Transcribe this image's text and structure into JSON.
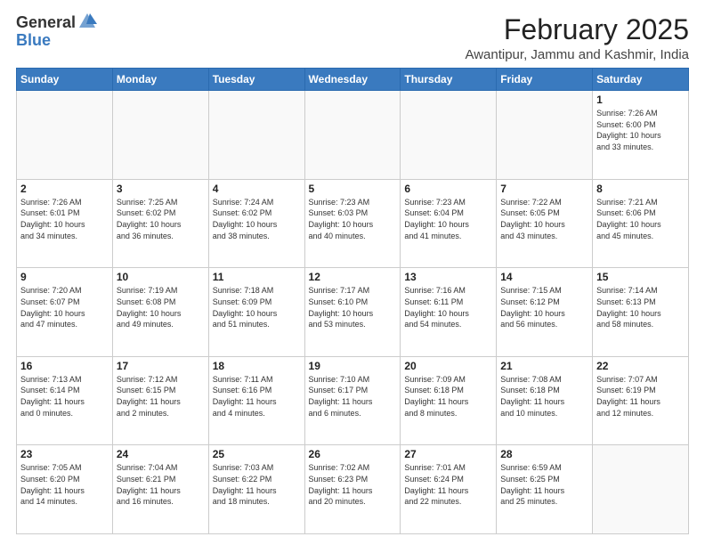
{
  "logo": {
    "general": "General",
    "blue": "Blue"
  },
  "header": {
    "month": "February 2025",
    "location": "Awantipur, Jammu and Kashmir, India"
  },
  "weekdays": [
    "Sunday",
    "Monday",
    "Tuesday",
    "Wednesday",
    "Thursday",
    "Friday",
    "Saturday"
  ],
  "weeks": [
    [
      {
        "day": "",
        "info": ""
      },
      {
        "day": "",
        "info": ""
      },
      {
        "day": "",
        "info": ""
      },
      {
        "day": "",
        "info": ""
      },
      {
        "day": "",
        "info": ""
      },
      {
        "day": "",
        "info": ""
      },
      {
        "day": "1",
        "info": "Sunrise: 7:26 AM\nSunset: 6:00 PM\nDaylight: 10 hours\nand 33 minutes."
      }
    ],
    [
      {
        "day": "2",
        "info": "Sunrise: 7:26 AM\nSunset: 6:01 PM\nDaylight: 10 hours\nand 34 minutes."
      },
      {
        "day": "3",
        "info": "Sunrise: 7:25 AM\nSunset: 6:02 PM\nDaylight: 10 hours\nand 36 minutes."
      },
      {
        "day": "4",
        "info": "Sunrise: 7:24 AM\nSunset: 6:02 PM\nDaylight: 10 hours\nand 38 minutes."
      },
      {
        "day": "5",
        "info": "Sunrise: 7:23 AM\nSunset: 6:03 PM\nDaylight: 10 hours\nand 40 minutes."
      },
      {
        "day": "6",
        "info": "Sunrise: 7:23 AM\nSunset: 6:04 PM\nDaylight: 10 hours\nand 41 minutes."
      },
      {
        "day": "7",
        "info": "Sunrise: 7:22 AM\nSunset: 6:05 PM\nDaylight: 10 hours\nand 43 minutes."
      },
      {
        "day": "8",
        "info": "Sunrise: 7:21 AM\nSunset: 6:06 PM\nDaylight: 10 hours\nand 45 minutes."
      }
    ],
    [
      {
        "day": "9",
        "info": "Sunrise: 7:20 AM\nSunset: 6:07 PM\nDaylight: 10 hours\nand 47 minutes."
      },
      {
        "day": "10",
        "info": "Sunrise: 7:19 AM\nSunset: 6:08 PM\nDaylight: 10 hours\nand 49 minutes."
      },
      {
        "day": "11",
        "info": "Sunrise: 7:18 AM\nSunset: 6:09 PM\nDaylight: 10 hours\nand 51 minutes."
      },
      {
        "day": "12",
        "info": "Sunrise: 7:17 AM\nSunset: 6:10 PM\nDaylight: 10 hours\nand 53 minutes."
      },
      {
        "day": "13",
        "info": "Sunrise: 7:16 AM\nSunset: 6:11 PM\nDaylight: 10 hours\nand 54 minutes."
      },
      {
        "day": "14",
        "info": "Sunrise: 7:15 AM\nSunset: 6:12 PM\nDaylight: 10 hours\nand 56 minutes."
      },
      {
        "day": "15",
        "info": "Sunrise: 7:14 AM\nSunset: 6:13 PM\nDaylight: 10 hours\nand 58 minutes."
      }
    ],
    [
      {
        "day": "16",
        "info": "Sunrise: 7:13 AM\nSunset: 6:14 PM\nDaylight: 11 hours\nand 0 minutes."
      },
      {
        "day": "17",
        "info": "Sunrise: 7:12 AM\nSunset: 6:15 PM\nDaylight: 11 hours\nand 2 minutes."
      },
      {
        "day": "18",
        "info": "Sunrise: 7:11 AM\nSunset: 6:16 PM\nDaylight: 11 hours\nand 4 minutes."
      },
      {
        "day": "19",
        "info": "Sunrise: 7:10 AM\nSunset: 6:17 PM\nDaylight: 11 hours\nand 6 minutes."
      },
      {
        "day": "20",
        "info": "Sunrise: 7:09 AM\nSunset: 6:18 PM\nDaylight: 11 hours\nand 8 minutes."
      },
      {
        "day": "21",
        "info": "Sunrise: 7:08 AM\nSunset: 6:18 PM\nDaylight: 11 hours\nand 10 minutes."
      },
      {
        "day": "22",
        "info": "Sunrise: 7:07 AM\nSunset: 6:19 PM\nDaylight: 11 hours\nand 12 minutes."
      }
    ],
    [
      {
        "day": "23",
        "info": "Sunrise: 7:05 AM\nSunset: 6:20 PM\nDaylight: 11 hours\nand 14 minutes."
      },
      {
        "day": "24",
        "info": "Sunrise: 7:04 AM\nSunset: 6:21 PM\nDaylight: 11 hours\nand 16 minutes."
      },
      {
        "day": "25",
        "info": "Sunrise: 7:03 AM\nSunset: 6:22 PM\nDaylight: 11 hours\nand 18 minutes."
      },
      {
        "day": "26",
        "info": "Sunrise: 7:02 AM\nSunset: 6:23 PM\nDaylight: 11 hours\nand 20 minutes."
      },
      {
        "day": "27",
        "info": "Sunrise: 7:01 AM\nSunset: 6:24 PM\nDaylight: 11 hours\nand 22 minutes."
      },
      {
        "day": "28",
        "info": "Sunrise: 6:59 AM\nSunset: 6:25 PM\nDaylight: 11 hours\nand 25 minutes."
      },
      {
        "day": "",
        "info": ""
      }
    ]
  ]
}
